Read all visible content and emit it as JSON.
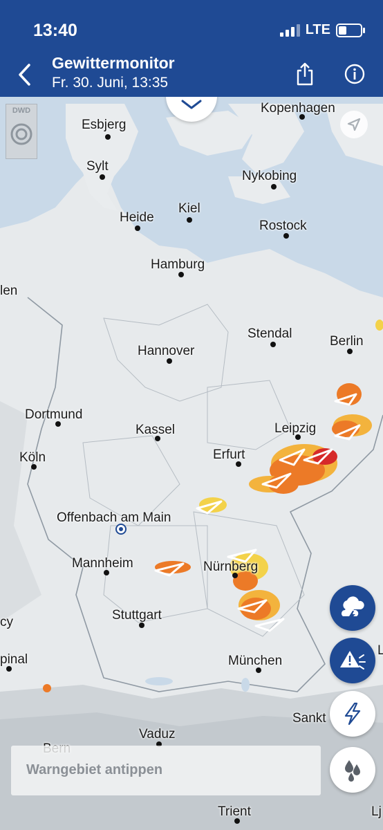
{
  "status": {
    "time": "13:40",
    "network": "LTE"
  },
  "header": {
    "title": "Gewittermonitor",
    "subtitle": "Fr. 30. Juni, 13:35"
  },
  "map": {
    "logo": "DWD",
    "cities": [
      "Kopenhagen",
      "Esbjerg",
      "Sylt",
      "Nykobing",
      "Heide",
      "Kiel",
      "Rostock",
      "Hamburg",
      "len",
      "Stendal",
      "Berlin",
      "Hannover",
      "Dortmund",
      "Kassel",
      "Leipzig",
      "Erfurt",
      "Köln",
      "Offenbach am Main",
      "Mannheim",
      "Nürnberg",
      "Stuttgart",
      "cy",
      "München",
      "pinal",
      "Sankt",
      "Vaduz",
      "Bern",
      "Trient",
      "Lj",
      "L"
    ]
  },
  "warning_hint": "Warngebiet antippen",
  "icons": [
    "back-icon",
    "share-icon",
    "info-icon",
    "chevron-down-icon",
    "locate-icon",
    "thunderstorm-layer-icon",
    "warning-layer-icon",
    "lightning-icon",
    "rain-icon"
  ]
}
